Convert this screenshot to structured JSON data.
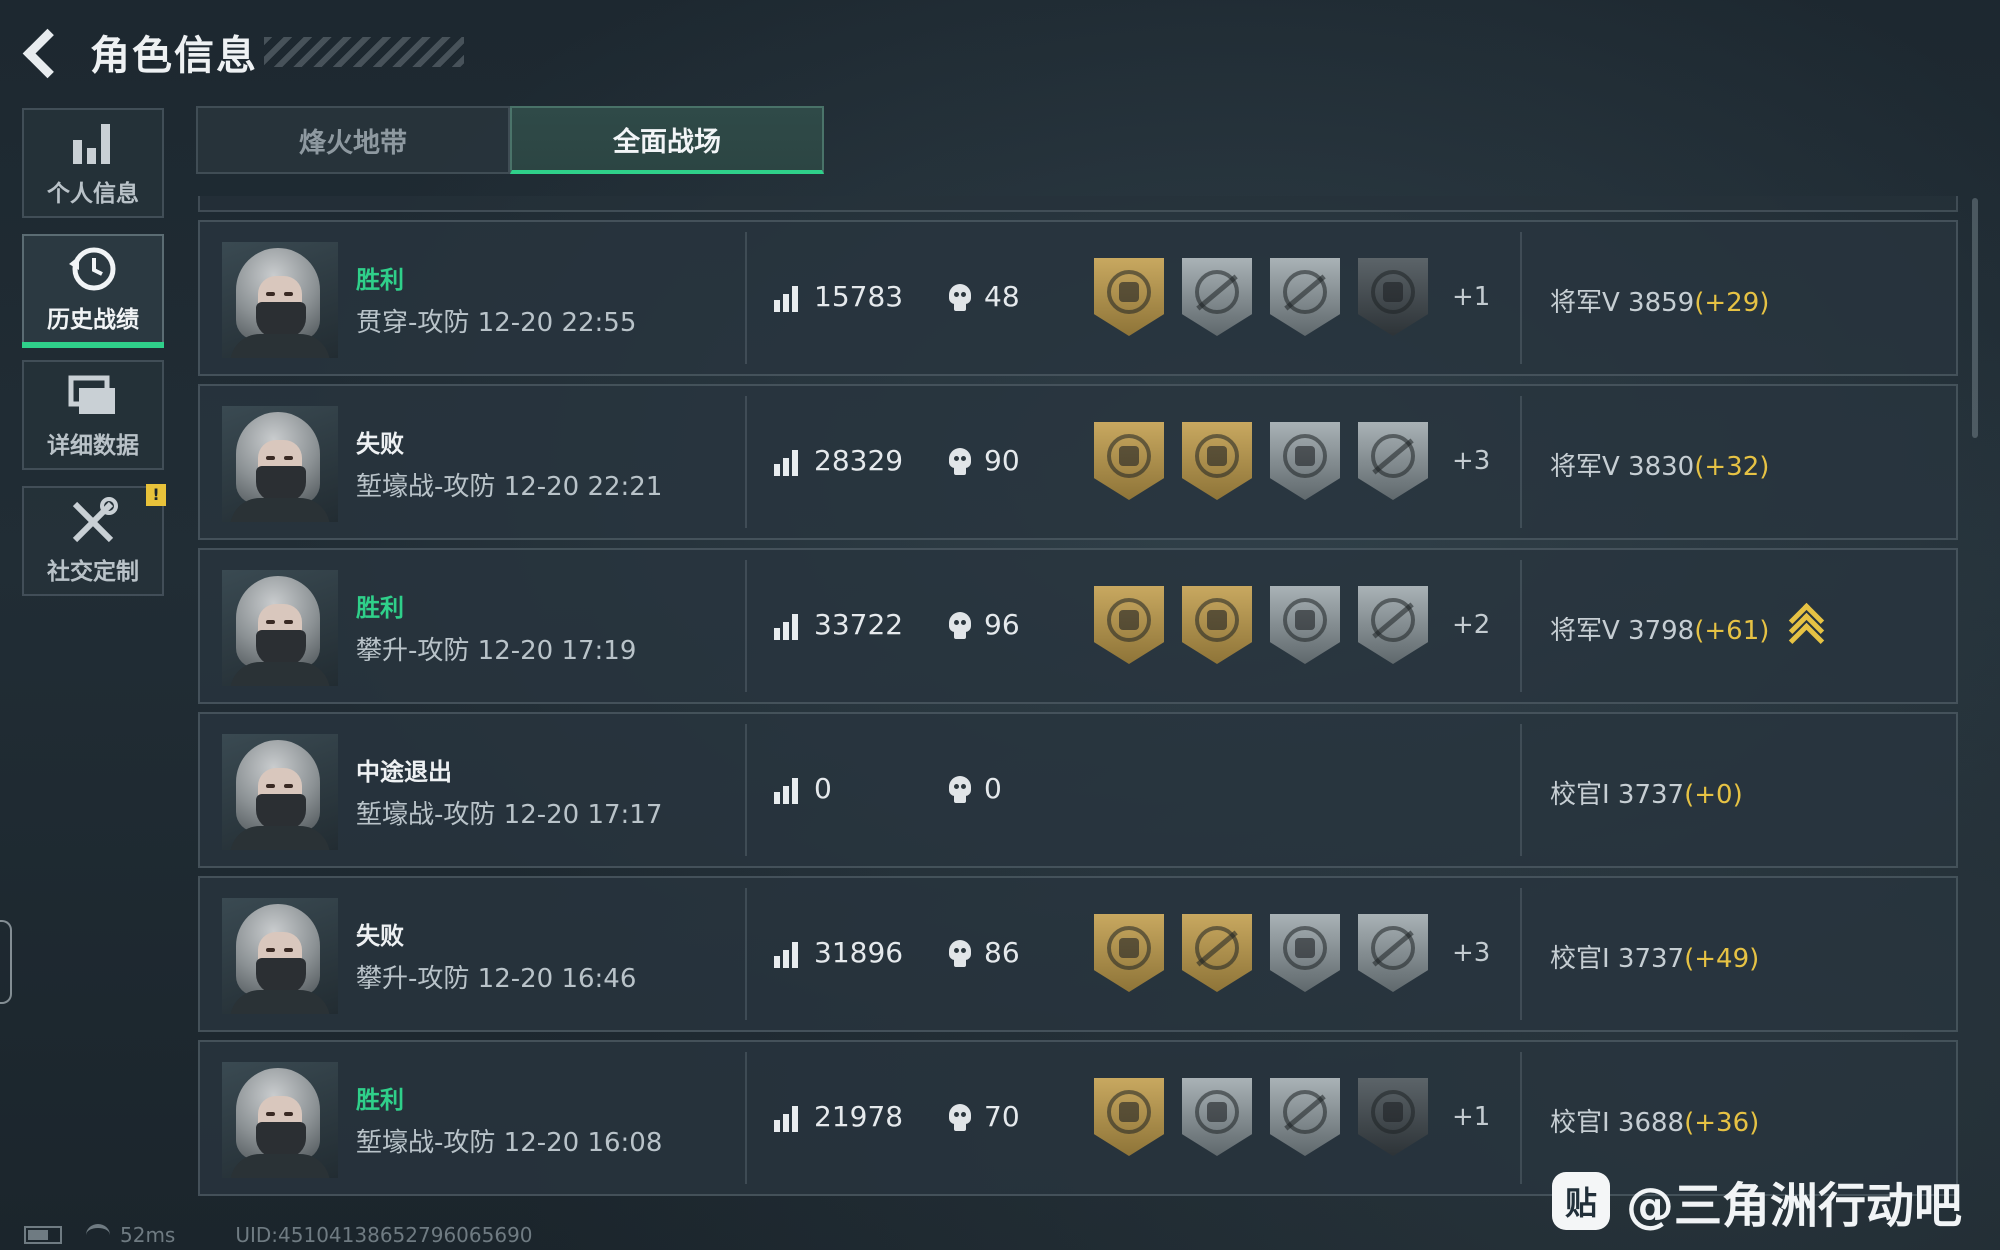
{
  "header": {
    "title": "角色信息"
  },
  "sidebar": {
    "items": [
      {
        "label": "个人信息",
        "icon": "bar-chart-icon",
        "active": false
      },
      {
        "label": "历史战绩",
        "icon": "history-clock-icon",
        "active": true
      },
      {
        "label": "详细数据",
        "icon": "folder-icon",
        "active": false
      },
      {
        "label": "社交定制",
        "icon": "tools-icon",
        "active": false,
        "badge": "!"
      }
    ]
  },
  "tabs": [
    {
      "label": "烽火地带",
      "active": false
    },
    {
      "label": "全面战场",
      "active": true
    }
  ],
  "matches": [
    {
      "result": "胜利",
      "win": true,
      "mode": "贯穿-攻防 12-20 22:55",
      "score": "15783",
      "kills": "48",
      "medals": [
        "gold",
        "silver",
        "silver",
        "dark"
      ],
      "extra": "+1",
      "rank": "将军V 3859",
      "delta": "(+29)",
      "rank_up": false
    },
    {
      "result": "失败",
      "win": false,
      "mode": "堑壕战-攻防 12-20 22:21",
      "score": "28329",
      "kills": "90",
      "medals": [
        "gold",
        "gold",
        "silver",
        "silver"
      ],
      "extra": "+3",
      "rank": "将军V 3830",
      "delta": "(+32)",
      "rank_up": false
    },
    {
      "result": "胜利",
      "win": true,
      "mode": "攀升-攻防 12-20 17:19",
      "score": "33722",
      "kills": "96",
      "medals": [
        "gold",
        "gold",
        "silver",
        "silver"
      ],
      "extra": "+2",
      "rank": "将军V 3798",
      "delta": "(+61)",
      "rank_up": true
    },
    {
      "result": "中途退出",
      "win": false,
      "mode": "堑壕战-攻防 12-20 17:17",
      "score": "0",
      "kills": "0",
      "medals": [],
      "extra": "",
      "rank": "校官Ⅰ 3737",
      "delta": "(+0)",
      "rank_up": false
    },
    {
      "result": "失败",
      "win": false,
      "mode": "攀升-攻防 12-20 16:46",
      "score": "31896",
      "kills": "86",
      "medals": [
        "gold",
        "gold",
        "silver",
        "silver"
      ],
      "extra": "+3",
      "rank": "校官Ⅰ 3737",
      "delta": "(+49)",
      "rank_up": false
    },
    {
      "result": "胜利",
      "win": true,
      "mode": "堑壕战-攻防 12-20 16:08",
      "score": "21978",
      "kills": "70",
      "medals": [
        "gold",
        "silver",
        "silver",
        "dark"
      ],
      "extra": "+1",
      "rank": "校官Ⅰ 3688",
      "delta": "(+36)",
      "rank_up": false
    }
  ],
  "footer": {
    "ping": "52ms",
    "uid": "UID:451041386527960656​90"
  },
  "watermark": {
    "logo": "贴",
    "text": "@三角洲行动吧"
  },
  "colors": {
    "accent_green": "#2fd08a",
    "gold": "#e6c244"
  }
}
